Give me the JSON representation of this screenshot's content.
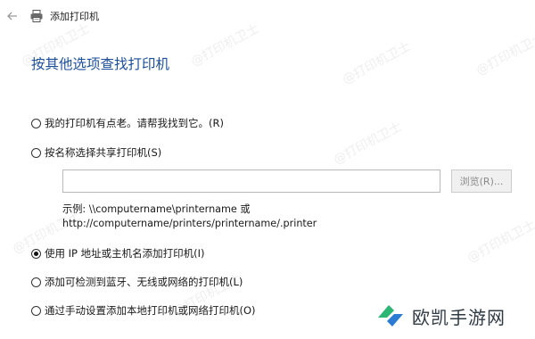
{
  "window": {
    "title": "添加打印机"
  },
  "heading": "按其他选项查找打印机",
  "options": [
    {
      "label": "我的打印机有点老。请帮我找到它。(R)",
      "checked": false
    },
    {
      "label": "按名称选择共享打印机(S)",
      "checked": false
    },
    {
      "label": "使用 IP 地址或主机名添加打印机(I)",
      "checked": true
    },
    {
      "label": "添加可检测到蓝牙、无线或网络的打印机(L)",
      "checked": false
    },
    {
      "label": "通过手动设置添加本地打印机或网络打印机(O)",
      "checked": false
    }
  ],
  "shared_printer": {
    "input_value": "",
    "browse_label": "浏览(R)...",
    "example_line1": "示例: \\\\computername\\printername 或",
    "example_line2": "http://computername/printers/printername/.printer"
  },
  "watermark": {
    "text": "@打印机卫士"
  },
  "brand": {
    "name": "欧凯手游网"
  },
  "colors": {
    "heading": "#1b4f9c",
    "brand_green": "#2bb673",
    "brand_blue": "#2a7bd1"
  },
  "icons": {
    "back": "back-arrow-icon",
    "printer": "printer-icon",
    "logo": "brand-logo-icon"
  }
}
